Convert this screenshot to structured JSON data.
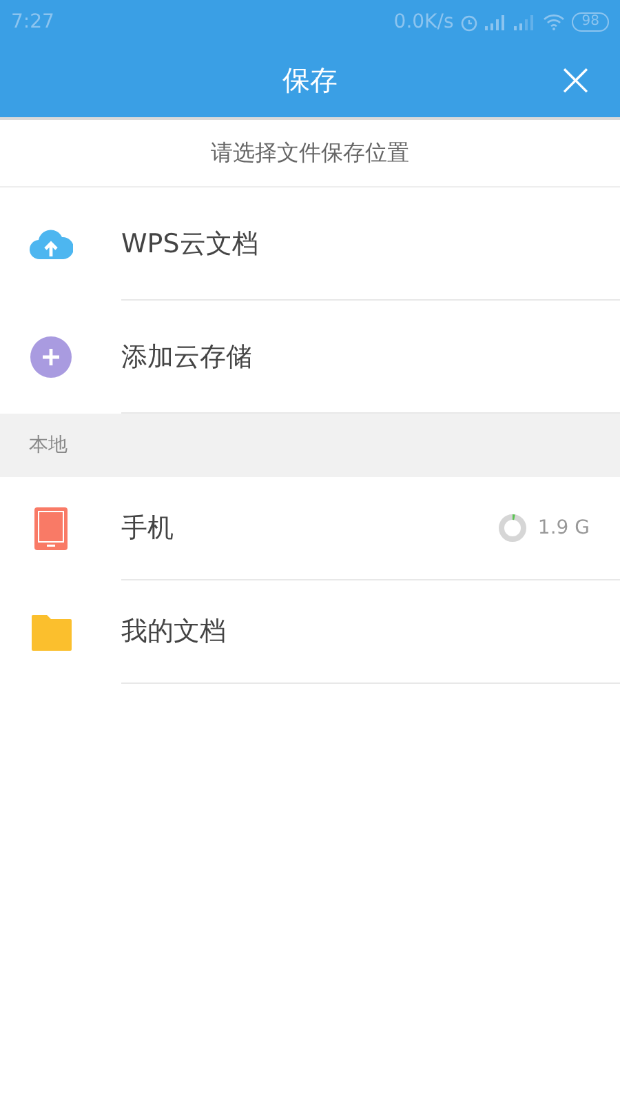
{
  "status_bar": {
    "time": "7:27",
    "speed": "0.0K/s",
    "battery": "98"
  },
  "header": {
    "title": "保存",
    "close": "×"
  },
  "prompt": "请选择文件保存位置",
  "cloud_items": [
    {
      "kind": "cloud",
      "label": "WPS云文档"
    },
    {
      "kind": "add",
      "label": "添加云存储"
    }
  ],
  "local_section": {
    "title": "本地",
    "items": [
      {
        "kind": "phone",
        "label": "手机",
        "storage": "1.9 G"
      },
      {
        "kind": "folder",
        "label": "我的文档"
      }
    ]
  }
}
